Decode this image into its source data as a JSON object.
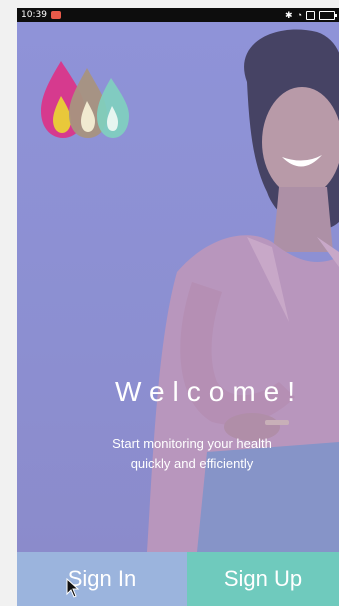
{
  "status_bar": {
    "time": "10:39",
    "icons": [
      "notification-app-icon",
      "bluetooth-icon",
      "wifi-icon",
      "sim-icon",
      "battery-icon"
    ]
  },
  "hero": {
    "title": "Welcome!",
    "subtitle_line1": "Start monitoring your health",
    "subtitle_line2": "quickly and efficiently"
  },
  "buttons": {
    "sign_in": "Sign In",
    "sign_up": "Sign Up"
  },
  "colors": {
    "overlay": "#8c90d3",
    "sign_in_bg": "#9bb4dd",
    "sign_up_bg": "#6fcabd",
    "logo_pink": "#d63a8e",
    "logo_yellow": "#e9c83a",
    "logo_taupe": "#a89480",
    "logo_teal": "#7fd1bf"
  },
  "logo": {
    "icon": "droplets-logo-icon"
  }
}
